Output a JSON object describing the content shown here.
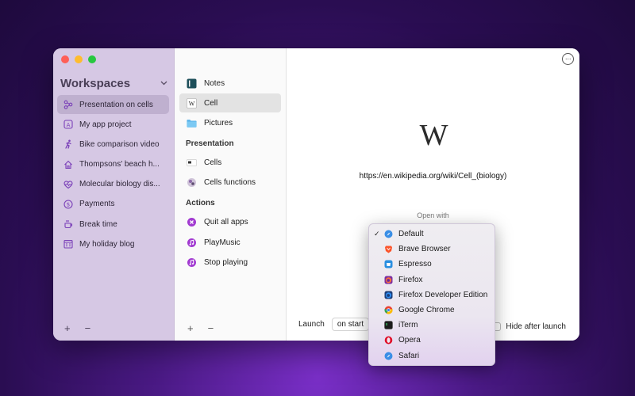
{
  "sidebar": {
    "title": "Workspaces",
    "items": [
      {
        "label": "Presentation on cells",
        "icon": "network-icon",
        "active": true
      },
      {
        "label": "My app project",
        "icon": "letter-a-icon",
        "active": false
      },
      {
        "label": "Bike comparison video",
        "icon": "cyclist-icon",
        "active": false
      },
      {
        "label": "Thompsons' beach h...",
        "icon": "house-icon",
        "active": false
      },
      {
        "label": "Molecular biology dis...",
        "icon": "heartbeat-icon",
        "active": false
      },
      {
        "label": "Payments",
        "icon": "dollar-icon",
        "active": false
      },
      {
        "label": "Break time",
        "icon": "coffee-icon",
        "active": false
      },
      {
        "label": "My holiday blog",
        "icon": "calendar-icon",
        "active": false
      }
    ],
    "add_label": "+",
    "remove_label": "−"
  },
  "middle": {
    "top_items": [
      {
        "label": "Notes",
        "icon": "notes-app-icon",
        "active": false
      },
      {
        "label": "Cell",
        "icon": "wikipedia-icon",
        "active": true
      },
      {
        "label": "Pictures",
        "icon": "folder-icon",
        "active": false
      }
    ],
    "sections": [
      {
        "title": "Presentation",
        "items": [
          {
            "label": "Cells",
            "icon": "keynote-icon"
          },
          {
            "label": "Cells functions",
            "icon": "image-thumb-icon"
          }
        ]
      },
      {
        "title": "Actions",
        "items": [
          {
            "label": "Quit all apps",
            "icon": "quit-action-icon"
          },
          {
            "label": "PlayMusic",
            "icon": "music-action-icon"
          },
          {
            "label": "Stop playing",
            "icon": "music-action-icon"
          }
        ]
      }
    ],
    "add_label": "+",
    "remove_label": "−"
  },
  "detail": {
    "logo_text": "W",
    "url": "https://en.wikipedia.org/wiki/Cell_(biology)",
    "open_with_label": "Open with",
    "launch_label": "Launch",
    "launch_value": "on start",
    "hide_label": "Hide after launch",
    "more_label": "···"
  },
  "browser_menu": {
    "selected": "Default",
    "options": [
      {
        "label": "Default",
        "icon": "safari-icon",
        "color": "#3a8ee6",
        "checked": true
      },
      {
        "label": "Brave Browser",
        "icon": "brave-icon",
        "color": "#fb542b",
        "checked": false
      },
      {
        "label": "Espresso",
        "icon": "espresso-icon",
        "color": "#2a8fe0",
        "checked": false
      },
      {
        "label": "Firefox",
        "icon": "firefox-icon",
        "color": "#e66000",
        "checked": false
      },
      {
        "label": "Firefox Developer Edition",
        "icon": "firefox-dev-icon",
        "color": "#1f5fbf",
        "checked": false
      },
      {
        "label": "Google Chrome",
        "icon": "chrome-icon",
        "color": "#34a853",
        "checked": false
      },
      {
        "label": "iTerm",
        "icon": "iterm-icon",
        "color": "#1c1c1c",
        "checked": false
      },
      {
        "label": "Opera",
        "icon": "opera-icon",
        "color": "#e0112b",
        "checked": false
      },
      {
        "label": "Safari",
        "icon": "safari-icon",
        "color": "#3a8ee6",
        "checked": false
      }
    ],
    "check_glyph": "✓"
  },
  "colors": {
    "accent": "#7a3fb8",
    "sidebar_bg": "#d6c8e4",
    "sidebar_active": "#bfb0cf"
  }
}
